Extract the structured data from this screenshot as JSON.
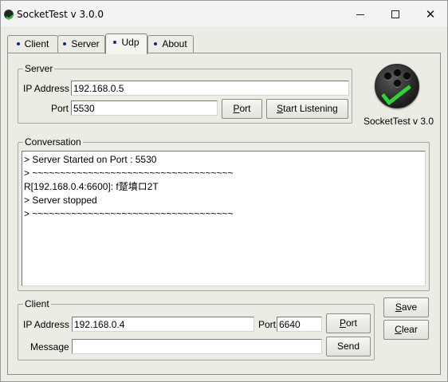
{
  "window": {
    "title": "SocketTest v 3.0.0",
    "icon": "sockettest-app-icon",
    "controls": {
      "minimize": "minimize-icon",
      "maximize": "maximize-icon",
      "close": "close-icon"
    }
  },
  "tabs": [
    {
      "label": "Client",
      "active": false
    },
    {
      "label": "Server",
      "active": false
    },
    {
      "label": "Udp",
      "active": true
    },
    {
      "label": "About",
      "active": false
    }
  ],
  "server": {
    "group_title": "Server",
    "ip_label": "IP Address",
    "ip_value": "192.168.0.5",
    "port_label": "Port",
    "port_value": "5530",
    "port_button": {
      "mnemonic": "P",
      "rest": "ort"
    },
    "listen_button": {
      "mnemonic": "S",
      "rest": "tart Listening"
    }
  },
  "logo": {
    "caption": "SocketTest v 3.0",
    "accent": "#30d23a"
  },
  "conversation": {
    "group_title": "Conversation",
    "lines": [
      "> Server Started on Port : 5530",
      "> ~~~~~~~~~~~~~~~~~~~~~~~~~~~~~~~~~~~~",
      "R[192.168.0.4:6600]: f蹵墳ロ2T",
      "> Server stopped",
      "> ~~~~~~~~~~~~~~~~~~~~~~~~~~~~~~~~~~~~"
    ]
  },
  "client": {
    "group_title": "Client",
    "ip_label": "IP Address",
    "ip_value": "192.168.0.4",
    "port_label": "Port",
    "port_value": "6640",
    "port_button": {
      "mnemonic": "P",
      "rest": "ort"
    },
    "message_label": "Message",
    "message_value": "",
    "send_button": "Send"
  },
  "side_buttons": {
    "save": {
      "mnemonic": "S",
      "rest": "ave"
    },
    "clear": {
      "mnemonic": "C",
      "rest": "lear"
    }
  }
}
